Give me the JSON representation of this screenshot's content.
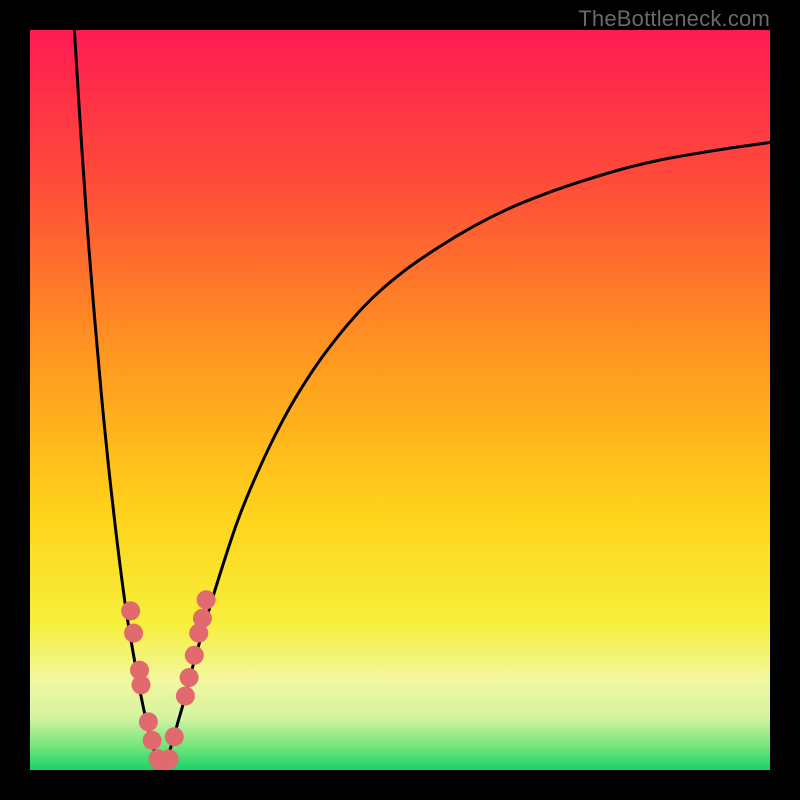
{
  "watermark": "TheBottleneck.com",
  "colors": {
    "frame": "#000000",
    "gradient_stops": [
      {
        "offset": 0.0,
        "color": "#ff1b52"
      },
      {
        "offset": 0.2,
        "color": "#ff4a3a"
      },
      {
        "offset": 0.45,
        "color": "#ff9a1f"
      },
      {
        "offset": 0.65,
        "color": "#ffd21a"
      },
      {
        "offset": 0.8,
        "color": "#f6ef3a"
      },
      {
        "offset": 0.88,
        "color": "#f3f7a1"
      },
      {
        "offset": 0.93,
        "color": "#d3f3a0"
      },
      {
        "offset": 0.97,
        "color": "#6fe47a"
      },
      {
        "offset": 1.0,
        "color": "#17d36b"
      }
    ],
    "curve": "#000000",
    "marker_fill": "#e06a6d",
    "marker_stroke": "#c14f54"
  },
  "chart_data": {
    "type": "line",
    "title": "",
    "xlabel": "",
    "ylabel": "",
    "xlim": [
      0,
      100
    ],
    "ylim": [
      0,
      100
    ],
    "x_optimum": 18,
    "series": [
      {
        "name": "left-branch",
        "x": [
          6,
          7,
          8,
          9,
          10,
          11,
          12,
          13,
          14,
          15,
          16,
          17,
          18
        ],
        "y": [
          100,
          84,
          70,
          58,
          47,
          37.5,
          29,
          21.5,
          15.5,
          10,
          5.5,
          2,
          0
        ]
      },
      {
        "name": "right-branch",
        "x": [
          18,
          19,
          20,
          21,
          22,
          24,
          26,
          28,
          30,
          33,
          36,
          40,
          45,
          50,
          55,
          60,
          65,
          70,
          75,
          80,
          85,
          90,
          95,
          100
        ],
        "y": [
          0,
          3,
          6.5,
          10,
          14,
          21,
          27.5,
          33.5,
          38.5,
          45,
          50.5,
          56.5,
          62.5,
          67,
          70.5,
          73.5,
          76,
          78,
          79.7,
          81.2,
          82.4,
          83.3,
          84.1,
          84.8
        ]
      }
    ],
    "markers": {
      "name": "highlighted-points",
      "points": [
        {
          "x": 13.6,
          "y": 21.5
        },
        {
          "x": 14.0,
          "y": 18.5
        },
        {
          "x": 14.8,
          "y": 13.5
        },
        {
          "x": 15.0,
          "y": 11.5
        },
        {
          "x": 16.0,
          "y": 6.5
        },
        {
          "x": 16.5,
          "y": 4.0
        },
        {
          "x": 17.3,
          "y": 1.5
        },
        {
          "x": 18.0,
          "y": 0.5
        },
        {
          "x": 18.8,
          "y": 1.5
        },
        {
          "x": 19.5,
          "y": 4.5
        },
        {
          "x": 21.0,
          "y": 10.0
        },
        {
          "x": 21.5,
          "y": 12.5
        },
        {
          "x": 22.2,
          "y": 15.5
        },
        {
          "x": 22.8,
          "y": 18.5
        },
        {
          "x": 23.3,
          "y": 20.5
        },
        {
          "x": 23.8,
          "y": 23.0
        }
      ],
      "radius": 9.5
    }
  }
}
